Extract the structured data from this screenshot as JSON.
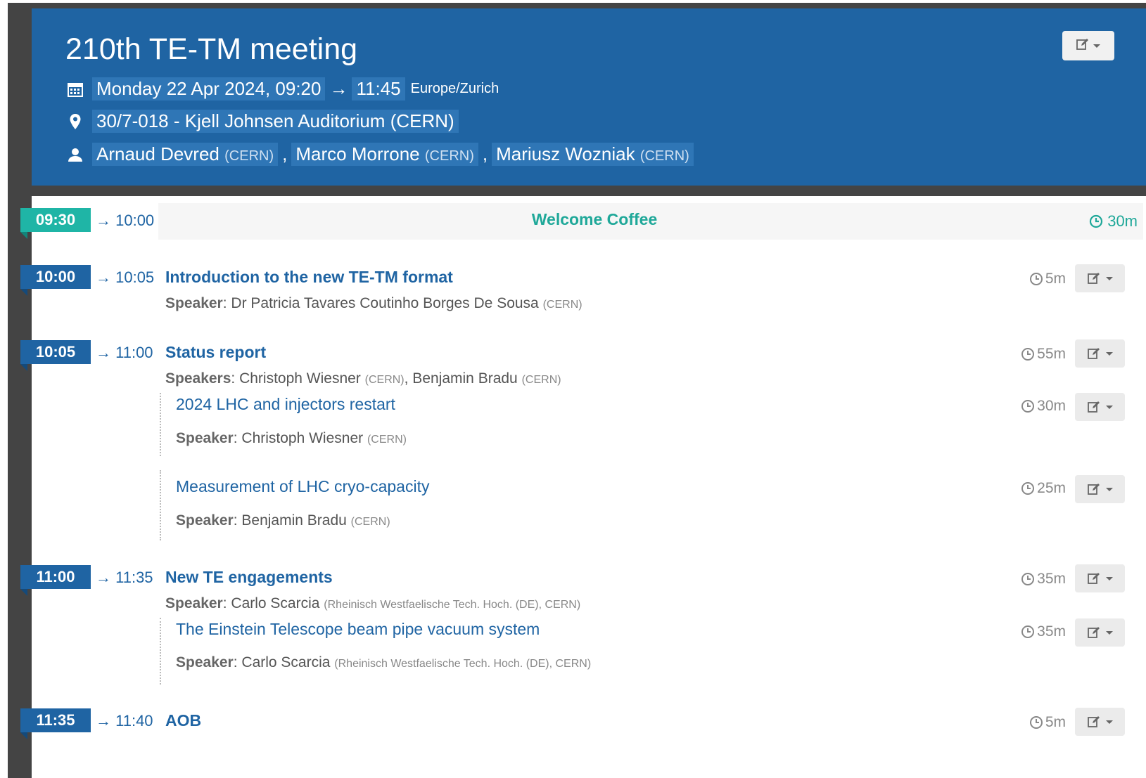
{
  "event": {
    "title": "210th TE-TM meeting",
    "date_start": "Monday 22 Apr 2024, 09:20",
    "arrow": "→",
    "time_end": "11:45",
    "timezone": "Europe/Zurich",
    "location": "30/7-018 - Kjell Johnsen Auditorium (CERN)",
    "chairs": [
      {
        "name": "Arnaud Devred",
        "affil": "(CERN)"
      },
      {
        "name": "Marco Morrone",
        "affil": "(CERN)"
      },
      {
        "name": "Mariusz Wozniak",
        "affil": "(CERN)"
      }
    ],
    "separator": ","
  },
  "timetable": [
    {
      "start": "09:30",
      "end": "→ 10:00",
      "title": "Welcome Coffee",
      "duration": "30m",
      "type": "break"
    },
    {
      "start": "10:00",
      "end": "→ 10:05",
      "title": "Introduction to the new TE-TM format",
      "duration": "5m",
      "speaker_label": "Speaker",
      "speaker_text": ": Dr Patricia Tavares Coutinho Borges De Sousa ",
      "speaker_affil": "(CERN)"
    },
    {
      "start": "10:05",
      "end": "→ 11:00",
      "title": "Status report",
      "duration": "55m",
      "speaker_label": "Speakers",
      "speaker_text": ": Christoph Wiesner ",
      "speaker_affil": "(CERN)",
      "speaker_text2": ", Benjamin Bradu ",
      "speaker_affil2": "(CERN)",
      "subs": [
        {
          "title": "2024 LHC and injectors restart",
          "duration": "30m",
          "speaker_label": "Speaker",
          "speaker_text": ": Christoph Wiesner ",
          "speaker_affil": "(CERN)"
        },
        {
          "title": "Measurement of LHC cryo-capacity",
          "duration": "25m",
          "speaker_label": "Speaker",
          "speaker_text": ": Benjamin Bradu ",
          "speaker_affil": "(CERN)"
        }
      ]
    },
    {
      "start": "11:00",
      "end": "→ 11:35",
      "title": "New TE engagements",
      "duration": "35m",
      "speaker_label": "Speaker",
      "speaker_text": ": Carlo Scarcia ",
      "speaker_affil": "(Rheinisch Westfaelische Tech. Hoch. (DE), CERN)",
      "subs": [
        {
          "title": "The Einstein Telescope beam pipe vacuum system",
          "duration": "35m",
          "speaker_label": "Speaker",
          "speaker_text": ": Carlo Scarcia ",
          "speaker_affil": "(Rheinisch Westfaelische Tech. Hoch. (DE), CERN)"
        }
      ]
    },
    {
      "start": "11:35",
      "end": "→ 11:40",
      "title": "AOB",
      "duration": "5m"
    }
  ],
  "icons": {
    "calendar": "calendar-icon",
    "location": "map-pin-icon",
    "person": "user-icon",
    "clock": "clock-icon",
    "edit": "edit-icon"
  },
  "colors": {
    "header_bg": "#1f64a3",
    "accent": "#1f64a3",
    "break": "#1fb5a6"
  }
}
